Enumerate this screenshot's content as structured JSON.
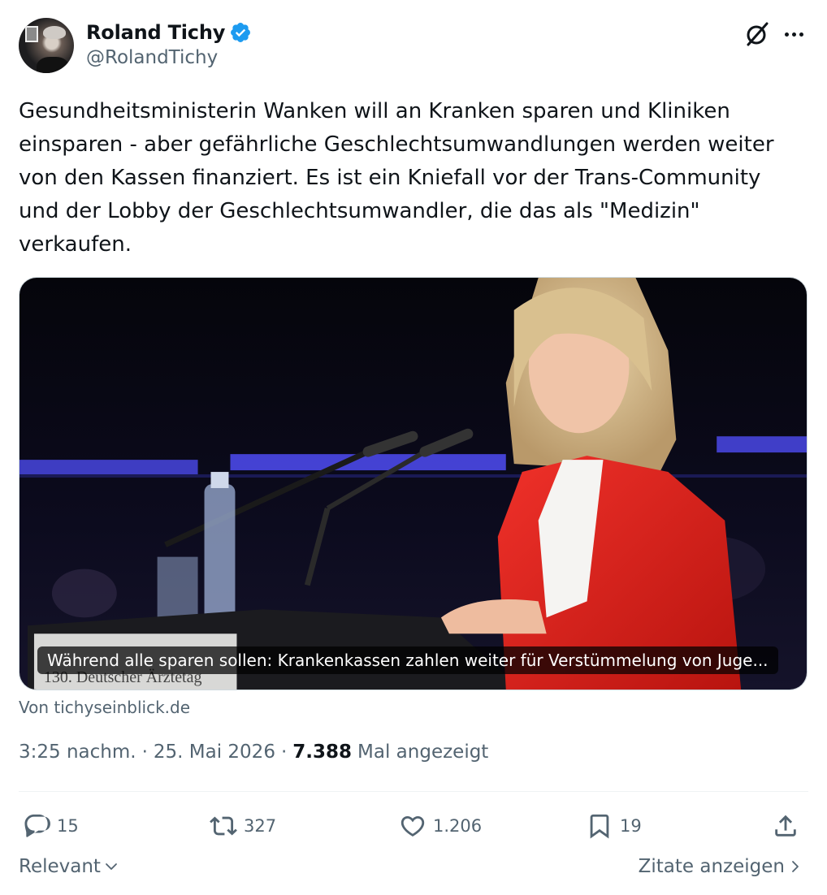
{
  "author": {
    "name": "Roland Tichy",
    "handle": "@RolandTichy"
  },
  "tweet": {
    "text": "Gesundheitsministerin Wanken will an Kranken sparen und Kliniken\neinsparen - aber gefährliche Geschlechtsumwandlungen werden weiter\nvon den Kassen finanziert. Es ist ein Kniefall vor der Trans-Community\nund der Lobby der Geschlechtsumwandler, die das als \"Medizin\"\nverkaufen."
  },
  "card": {
    "caption": "Während alle sparen sollen: Krankenkassen zahlen weiter für Verstümmelung von Juge...",
    "podium_text": "130. Deutscher Ärztetag",
    "source": "Von tichyseinblick.de"
  },
  "meta": {
    "time": "3:25 nachm.",
    "separator": "·",
    "date": "25. Mai 2026",
    "views": "7.388",
    "views_label": "Mal angezeigt"
  },
  "actions": {
    "replies": "15",
    "reposts": "327",
    "likes": "1.206",
    "bookmarks": "19"
  },
  "footer": {
    "sort_label": "Relevant",
    "quotes_label": "Zitate anzeigen"
  },
  "colors": {
    "text": "#0f1419",
    "secondary": "#536471",
    "verified": "#1d9bf0",
    "border": "#eff3f4"
  },
  "icons": [
    "verified-badge-icon",
    "grok-icon",
    "more-icon",
    "reply-icon",
    "repost-icon",
    "like-icon",
    "bookmark-icon",
    "share-icon",
    "chevron-down-icon",
    "chevron-right-icon"
  ]
}
